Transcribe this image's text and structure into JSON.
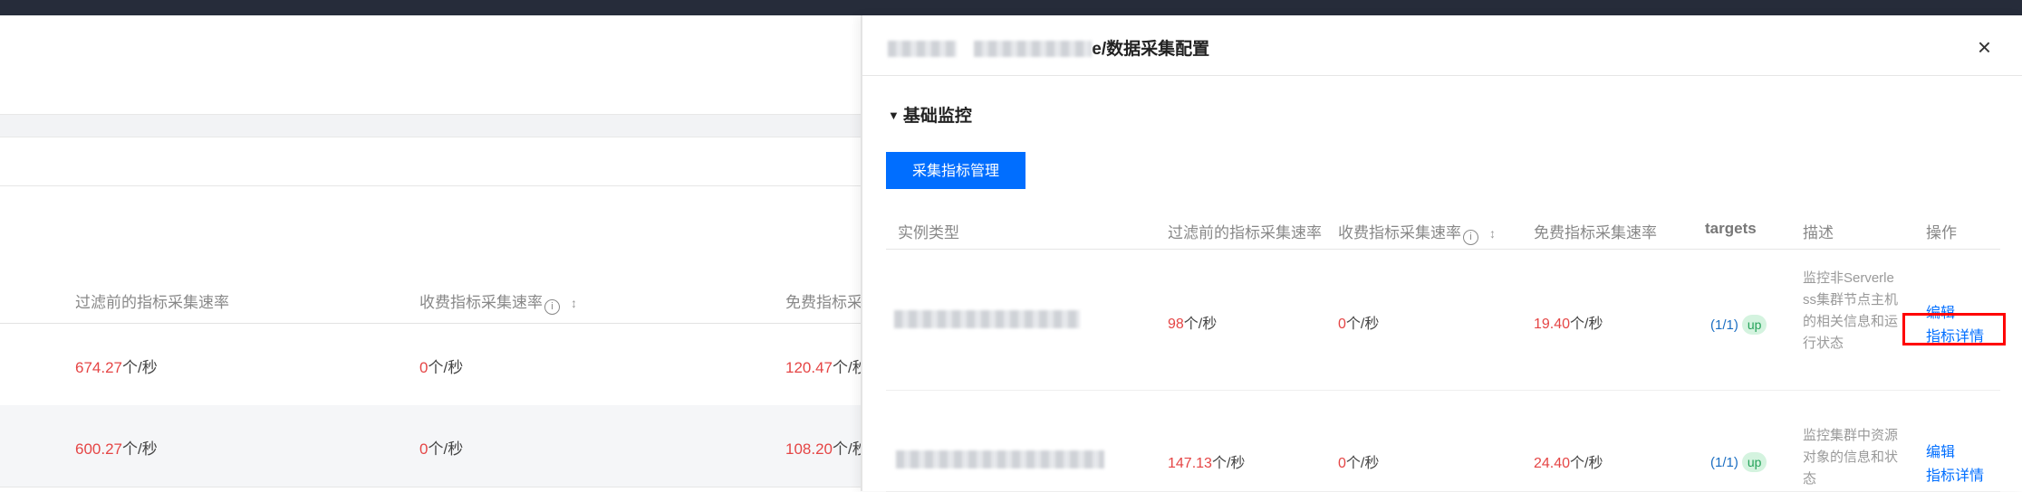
{
  "background_table": {
    "columns": [
      "过滤前的指标采集速率",
      "收费指标采集速率",
      "免费指标采"
    ],
    "rows": [
      {
        "before_value": "674.27",
        "before_unit": "个/秒",
        "charged_value": "0",
        "charged_unit": "个/秒",
        "free_value": "120.47",
        "free_unit": "个/秒"
      },
      {
        "before_value": "600.27",
        "before_unit": "个/秒",
        "charged_value": "0",
        "charged_unit": "个/秒",
        "free_value": "108.20",
        "free_unit": "个/秒"
      }
    ]
  },
  "drawer": {
    "title_fragment": "e/数据采集配置",
    "close": "×",
    "section": {
      "toggle": "▼",
      "title": "基础监控"
    },
    "manage_button": "采集指标管理",
    "columns": [
      "实例类型",
      "过滤前的指标采集速率",
      "收费指标采集速率",
      "免费指标采集速率",
      "targets",
      "描述",
      "操作"
    ],
    "rows": [
      {
        "before_value": "98",
        "before_unit": "个/秒",
        "charged_value": "0",
        "charged_unit": "个/秒",
        "free_value": "19.40",
        "free_unit": "个/秒",
        "targets": "(1/1)",
        "status": "up",
        "description": "监控非Serverless集群节点主机的相关信息和运行状态",
        "edit": "编辑",
        "details": "指标详情"
      },
      {
        "before_value": "147.13",
        "before_unit": "个/秒",
        "charged_value": "0",
        "charged_unit": "个/秒",
        "free_value": "24.40",
        "free_unit": "个/秒",
        "targets": "(1/1)",
        "status": "up",
        "description": "监控集群中资源对象的信息和状态",
        "edit": "编辑",
        "details": "指标详情"
      }
    ]
  },
  "icons": {
    "info": "i",
    "sort": "↕"
  },
  "colors": {
    "accent": "#006eff",
    "value_red": "#e54545",
    "highlight": "#ff0000",
    "up_badge_bg": "#d4f3df"
  }
}
